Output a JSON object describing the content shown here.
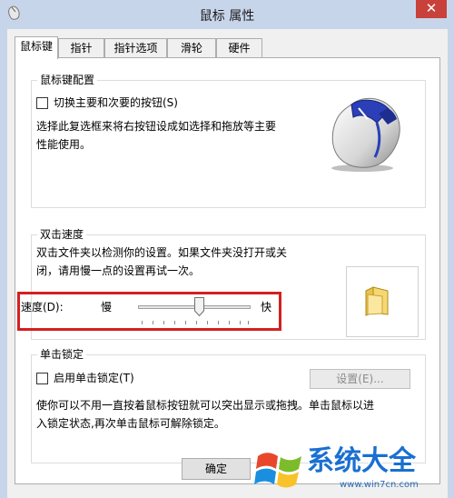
{
  "window": {
    "title": "鼠标 属性",
    "close_glyph": "✕",
    "close_color": "#c8413a"
  },
  "tabs": [
    {
      "label": "鼠标键",
      "active": true
    },
    {
      "label": "指针",
      "active": false
    },
    {
      "label": "指针选项",
      "active": false
    },
    {
      "label": "滑轮",
      "active": false
    },
    {
      "label": "硬件",
      "active": false
    }
  ],
  "button_config": {
    "title": "鼠标键配置",
    "swap_label": "切换主要和次要的按钮(S)",
    "swap_checked": false,
    "desc_line1": "选择此复选框来将右按钮设成如选择和拖放等主要",
    "desc_line2": "性能使用。",
    "image_icon": "mouse-icon"
  },
  "double_click": {
    "title": "双击速度",
    "desc_line1": "双击文件夹以检测你的设置。如果文件夹没打开或关",
    "desc_line2": "闭，请用慢一点的设置再试一次。",
    "speed_label": "速度(D):",
    "slow_label": "慢",
    "fast_label": "快",
    "speed_fraction": 0.55,
    "test_icon": "folder-icon",
    "highlight_color": "#d42020"
  },
  "click_lock": {
    "title": "单击锁定",
    "enable_label": "启用单击锁定(T)",
    "enable_checked": false,
    "settings_label": "设置(E)...",
    "desc_line1": "使你可以不用一直按着鼠标按钮就可以突出显示或拖拽。单击鼠标以进",
    "desc_line2": "入锁定状态,再次单击鼠标可解除锁定。"
  },
  "ok_label": "确定",
  "watermark": {
    "logo_icon": "windows-logo-icon",
    "text": "系统大全",
    "url": "www.win7cn.com",
    "text_color": "#1a6fd1"
  }
}
